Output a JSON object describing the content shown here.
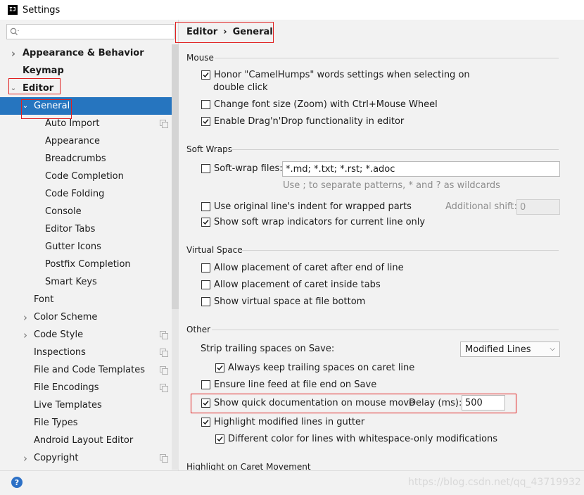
{
  "window": {
    "title": "Settings",
    "app_icon": "IJ"
  },
  "search": {
    "placeholder": "",
    "value": ""
  },
  "tree": [
    {
      "label": "Appearance & Behavior",
      "bold": true,
      "level": 0,
      "arrow": "right"
    },
    {
      "label": "Keymap",
      "bold": true,
      "level": 0,
      "arrow": ""
    },
    {
      "label": "Editor",
      "bold": true,
      "level": 0,
      "arrow": "down"
    },
    {
      "label": "General",
      "bold": false,
      "level": 1,
      "arrow": "down",
      "selected": true
    },
    {
      "label": "Auto Import",
      "level": 2,
      "icon": "copy-icon"
    },
    {
      "label": "Appearance",
      "level": 2
    },
    {
      "label": "Breadcrumbs",
      "level": 2
    },
    {
      "label": "Code Completion",
      "level": 2
    },
    {
      "label": "Code Folding",
      "level": 2
    },
    {
      "label": "Console",
      "level": 2
    },
    {
      "label": "Editor Tabs",
      "level": 2
    },
    {
      "label": "Gutter Icons",
      "level": 2
    },
    {
      "label": "Postfix Completion",
      "level": 2
    },
    {
      "label": "Smart Keys",
      "level": 2
    },
    {
      "label": "Font",
      "level": 1
    },
    {
      "label": "Color Scheme",
      "level": 1,
      "arrow": "right"
    },
    {
      "label": "Code Style",
      "level": 1,
      "arrow": "right",
      "icon": "copy-icon"
    },
    {
      "label": "Inspections",
      "level": 1,
      "icon": "copy-icon"
    },
    {
      "label": "File and Code Templates",
      "level": 1,
      "icon": "copy-icon"
    },
    {
      "label": "File Encodings",
      "level": 1,
      "icon": "copy-icon"
    },
    {
      "label": "Live Templates",
      "level": 1
    },
    {
      "label": "File Types",
      "level": 1
    },
    {
      "label": "Android Layout Editor",
      "level": 1
    },
    {
      "label": "Copyright",
      "level": 1,
      "arrow": "right",
      "icon": "copy-icon"
    }
  ],
  "breadcrumb": {
    "first": "Editor",
    "separator": "›",
    "second": "General"
  },
  "groups": {
    "mouse": "Mouse",
    "soft_wraps": "Soft Wraps",
    "virtual_space": "Virtual Space",
    "other": "Other",
    "highlight_caret": "Highlight on Caret Movement"
  },
  "mouse": {
    "camelhumps_line1": "Honor \"CamelHumps\" words settings when selecting on",
    "camelhumps_line2": "double click",
    "camelhumps_checked": true,
    "zoom": "Change font size (Zoom) with Ctrl+Mouse Wheel",
    "zoom_checked": false,
    "dragdrop": "Enable Drag'n'Drop functionality in editor",
    "dragdrop_checked": true
  },
  "soft_wraps": {
    "files_label": "Soft-wrap files:",
    "files_checked": false,
    "files_value": "*.md; *.txt; *.rst; *.adoc",
    "hint": "Use ; to separate patterns, * and ? as wildcards",
    "original_indent": "Use original line's indent for wrapped parts",
    "original_indent_checked": false,
    "additional_shift_label": "Additional shift:",
    "additional_shift_value": "0",
    "indicators": "Show soft wrap indicators for current line only",
    "indicators_checked": true
  },
  "virtual_space": {
    "after_end": "Allow placement of caret after end of line",
    "after_end_checked": false,
    "inside_tabs": "Allow placement of caret inside tabs",
    "inside_tabs_checked": false,
    "file_bottom": "Show virtual space at file bottom",
    "file_bottom_checked": false
  },
  "other": {
    "strip_label": "Strip trailing spaces on Save:",
    "strip_value": "Modified Lines",
    "keep_trailing": "Always keep trailing spaces on caret line",
    "keep_trailing_checked": true,
    "line_feed": "Ensure line feed at file end on Save",
    "line_feed_checked": false,
    "quick_doc": "Show quick documentation on mouse move",
    "quick_doc_checked": true,
    "delay_label": "Delay (ms):",
    "delay_value": "500",
    "highlight_modified": "Highlight modified lines in gutter",
    "highlight_modified_checked": true,
    "diff_color": "Different color for lines with whitespace-only modifications",
    "diff_color_checked": true
  },
  "footer": {
    "watermark": "https://blog.csdn.net/qq_43719932"
  },
  "colors": {
    "selection": "#2675bf",
    "annotation_red": "#e02020",
    "help": "#2c70c6"
  }
}
